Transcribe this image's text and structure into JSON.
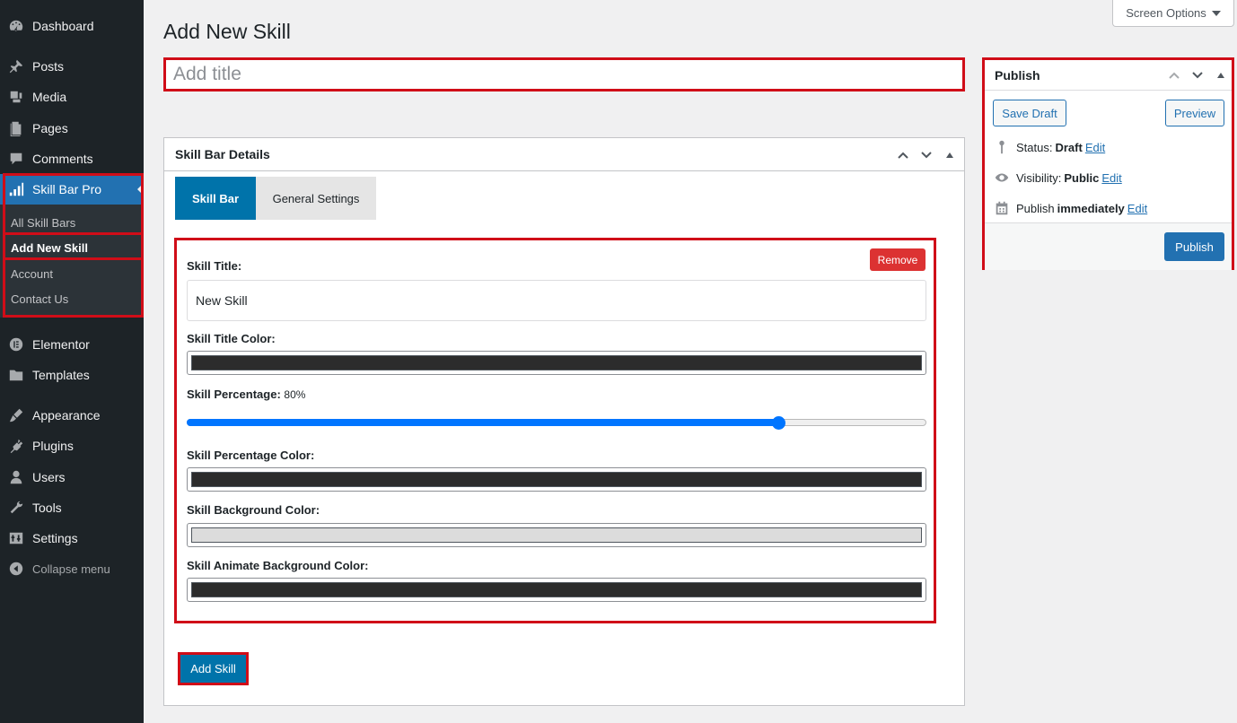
{
  "sidebar": {
    "items": [
      {
        "label": "Dashboard",
        "icon": "dashboard-icon"
      },
      {
        "label": "Posts",
        "icon": "pin-icon"
      },
      {
        "label": "Media",
        "icon": "media-icon"
      },
      {
        "label": "Pages",
        "icon": "pages-icon"
      },
      {
        "label": "Comments",
        "icon": "comment-icon"
      },
      {
        "label": "Skill Bar Pro",
        "icon": "bar-chart-icon"
      },
      {
        "label": "Elementor",
        "icon": "elementor-icon"
      },
      {
        "label": "Templates",
        "icon": "folder-icon"
      },
      {
        "label": "Appearance",
        "icon": "brush-icon"
      },
      {
        "label": "Plugins",
        "icon": "plugin-icon"
      },
      {
        "label": "Users",
        "icon": "user-icon"
      },
      {
        "label": "Tools",
        "icon": "wrench-icon"
      },
      {
        "label": "Settings",
        "icon": "settings-icon"
      },
      {
        "label": "Collapse menu",
        "icon": "collapse-icon"
      }
    ],
    "submenu": [
      "All Skill Bars",
      "Add New Skill",
      "Account",
      "Contact Us"
    ]
  },
  "header": {
    "title": "Add New Skill",
    "screen_options": "Screen Options"
  },
  "title_field": {
    "placeholder": "Add title",
    "value": ""
  },
  "details": {
    "heading": "Skill Bar Details",
    "tabs": [
      "Skill Bar",
      "General Settings"
    ],
    "remove_label": "Remove",
    "skill_title_label": "Skill Title:",
    "skill_title_value": "New Skill",
    "title_color_label": "Skill Title Color:",
    "title_color": "#2c2c2c",
    "percentage_label": "Skill Percentage:",
    "percentage_text": "80%",
    "percentage_value": 0.8,
    "percentage_color_label": "Skill Percentage Color:",
    "percentage_color": "#2c2c2c",
    "background_color_label": "Skill Background Color:",
    "background_color": "#dcdcdc",
    "animate_color_label": "Skill Animate Background Color:",
    "animate_color": "#2c2c2c",
    "add_skill_label": "Add Skill"
  },
  "publish": {
    "heading": "Publish",
    "save_draft": "Save Draft",
    "preview": "Preview",
    "status_label": "Status:",
    "status_value": "Draft",
    "visibility_label": "Visibility:",
    "visibility_value": "Public",
    "publish_label": "Publish",
    "publish_value": "immediately",
    "edit_label": "Edit",
    "publish_button": "Publish"
  },
  "colors": {
    "sidebar_bg": "#1d2327",
    "accent": "#2271b1",
    "highlight_border": "#d00d18",
    "remove_red": "#dc3232"
  }
}
